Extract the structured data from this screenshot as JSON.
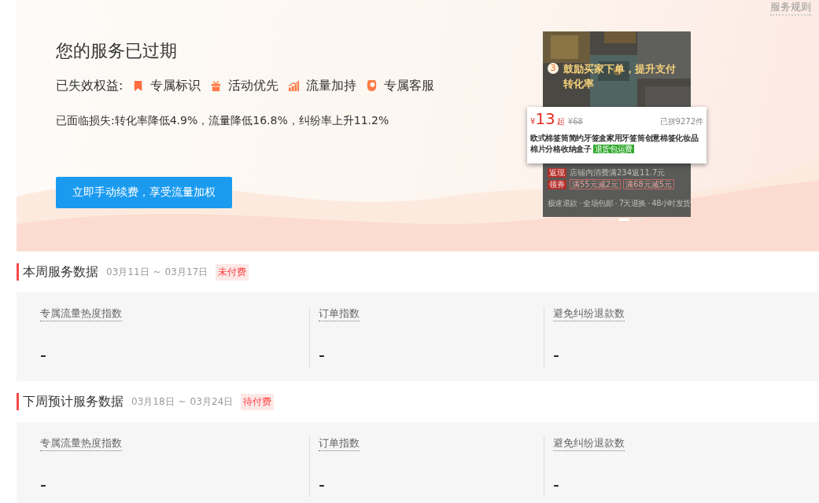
{
  "rules_link": "服务规则",
  "hero": {
    "title": "您的服务已过期",
    "benefits_label": "已失效权益:",
    "benefits": [
      {
        "label": "专属标识"
      },
      {
        "label": "活动优先"
      },
      {
        "label": "流量加持"
      },
      {
        "label": "专属客服"
      }
    ],
    "loss_text": "已面临损失:转化率降低4.9%，流量降低16.8%，纠纷率上升11.2%",
    "button": "立即手动续费，享受流量加权"
  },
  "promo": {
    "badge": "3",
    "caption": "鼓励买家下单，提升支付转化率",
    "price_symbol": "¥",
    "price": "13",
    "price_suffix": "起",
    "original_price": "¥68",
    "sold": "已拼9272件",
    "title": "欧式棉签筒简约牙签盒家用牙签筒创意棉签化妆品棉片分格收纳盒子",
    "tag": "退货包运费",
    "cashback_tag": "返现",
    "cashback_text": "店铺内消费满234返11.7元",
    "coupon_tag": "领券",
    "coupons": [
      "满55元减2元",
      "满68元减5元"
    ],
    "services": "极速退款 · 全场包邮 · 7天退换 · 48小时发货",
    "dots": [
      {
        "selected": false
      },
      {
        "selected": false
      },
      {
        "selected": true
      },
      {
        "selected": false
      }
    ]
  },
  "sections": [
    {
      "title": "本周服务数据",
      "date_start": "03月11日",
      "separator": "~",
      "date_end": "03月17日",
      "status": "未付费",
      "metrics": [
        {
          "label": "专属流量热度指数",
          "value": "-"
        },
        {
          "label": "订单指数",
          "value": "-"
        },
        {
          "label": "避免纠纷退款数",
          "value": "-"
        }
      ]
    },
    {
      "title": "下周预计服务数据",
      "date_start": "03月18日",
      "separator": "~",
      "date_end": "03月24日",
      "status": "待付费",
      "metrics": [
        {
          "label": "专属流量热度指数",
          "value": "-"
        },
        {
          "label": "订单指数",
          "value": "-"
        },
        {
          "label": "避免纠纷退款数",
          "value": "-"
        }
      ]
    }
  ]
}
